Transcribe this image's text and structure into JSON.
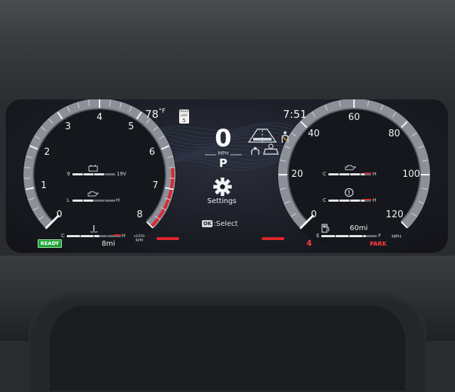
{
  "status_bar": {
    "outside_temp": "78",
    "temp_unit": "°F",
    "speed_limit_caption": "SPEED LIMIT",
    "speed_limit_value": "5",
    "clock": "7:51"
  },
  "center": {
    "speed": "0",
    "speed_unit": "MPH",
    "gear": "P",
    "settings_label": "Settings",
    "ok_button": "OK",
    "ok_hint": ":Select",
    "icons": [
      "lane-departure-icon",
      "seatbelt-icon",
      "pre-collision-icon",
      "lane-tracing-icon",
      "vehicle-distance-icon"
    ]
  },
  "tachometer": {
    "ticks": [
      "0",
      "1",
      "2",
      "3",
      "4",
      "5",
      "6",
      "7",
      "8"
    ],
    "unit_line1": "x1000",
    "unit_line2": "RPM",
    "redline_from": 6.5,
    "reading": 0,
    "battery_gauge": {
      "min": "9",
      "max": "19V",
      "level": 0.75
    },
    "oil_pressure_gauge": {
      "min": "L",
      "max": "H",
      "level": 0.5
    },
    "coolant_gauge": {
      "min": "C",
      "max": "H",
      "level": 0.6
    },
    "ready_label": "READY",
    "odometer": "8mi"
  },
  "speedometer": {
    "ticks": [
      "0",
      "20",
      "40",
      "60",
      "80",
      "100",
      "120"
    ],
    "unit": "MPH",
    "reading": 0,
    "oil_temp_gauge": {
      "min": "C",
      "max": "H",
      "level": 0.85
    },
    "trans_temp_gauge": {
      "min": "C",
      "max": "H",
      "level": 0.85
    },
    "fuel_gauge": {
      "min": "E",
      "max": "F",
      "level": 0.8
    },
    "range": "60mi",
    "drive_mode": "4",
    "park_label": "PARK"
  },
  "colors": {
    "accent_red": "#e0262c",
    "ready_green": "#1fa339",
    "gauge_ring": "#8c9098",
    "screen_bg": "#1a1c24"
  }
}
